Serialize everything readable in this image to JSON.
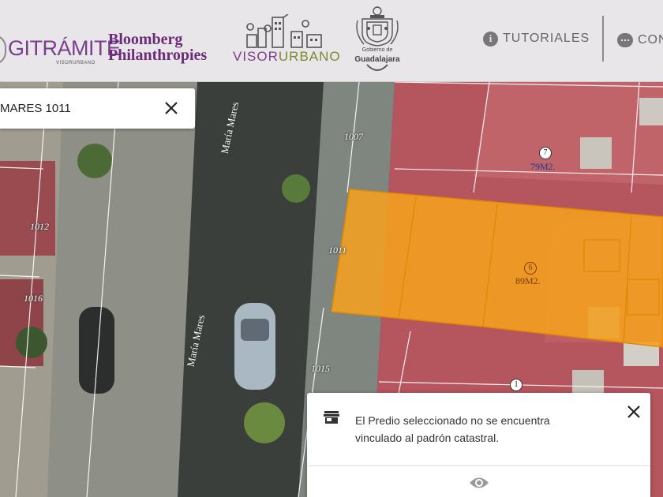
{
  "header": {
    "logos": {
      "gitramite": {
        "name": "GITRÁMITE",
        "sub": "VISORURBANO"
      },
      "bloomberg": {
        "line1": "Bloomberg",
        "line2": "Philanthropies"
      },
      "visor": {
        "part1": "VISOR",
        "part2": "URBANO"
      },
      "gobierno": {
        "line1": "Gobierno de",
        "line2": "Guadalajara"
      }
    },
    "nav": {
      "tutoriales": {
        "label": "TUTORIALES",
        "icon": "info-icon"
      },
      "contacto": {
        "label": "CON",
        "icon": "chat-icon"
      }
    }
  },
  "search": {
    "value": "MARES 1011",
    "close_icon": "close-icon"
  },
  "map": {
    "street_labels": [
      "María Mares",
      "María Mares"
    ],
    "house_numbers": [
      "1007",
      "1012",
      "1016",
      "1011",
      "1015"
    ],
    "lots": [
      {
        "number": "7",
        "area": "79M2."
      },
      {
        "number": "6",
        "area": "89M2."
      },
      {
        "number": "1"
      }
    ],
    "colors": {
      "selected_parcel": "#f5a020",
      "parcel_lines": "#ffffff"
    }
  },
  "info_card": {
    "icon": "store-icon",
    "message": "El Predio seleccionado no se encuentra vinculado al padrón catastral.",
    "close_icon": "close-icon",
    "view_icon": "eye-icon"
  }
}
